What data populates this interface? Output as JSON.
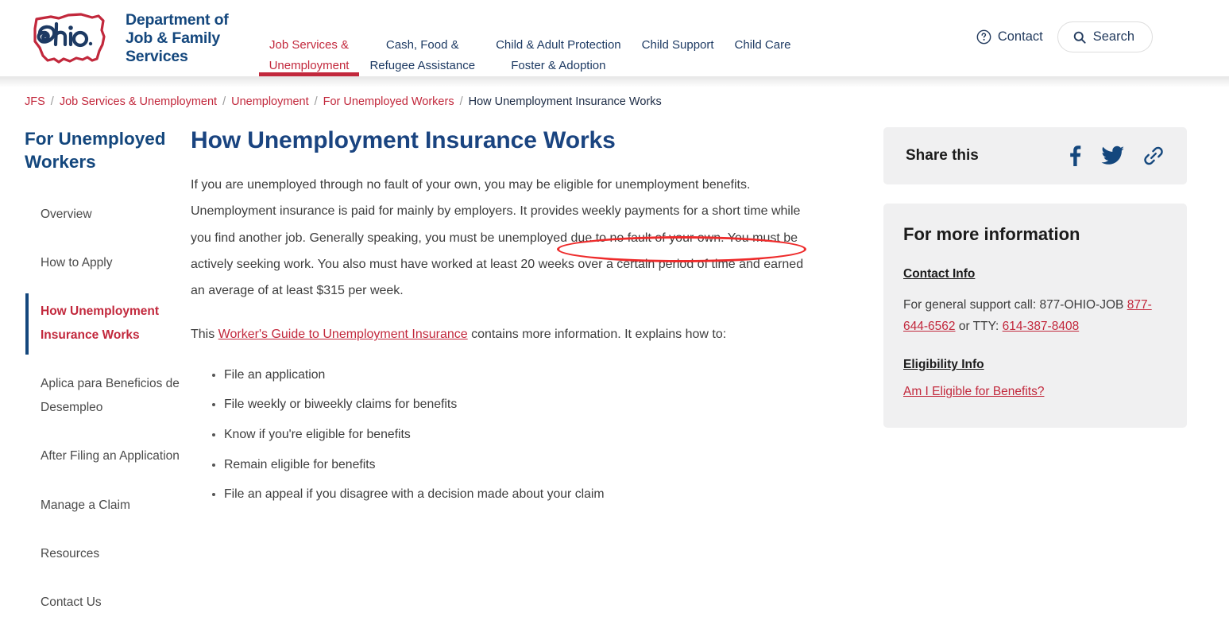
{
  "header": {
    "logo": {
      "icon": "ohio-state-outline-logo",
      "script_word": "Ohio",
      "agency_line1": "Department of",
      "agency_line2": "Job & Family",
      "agency_line3": "Services"
    },
    "nav": [
      {
        "label": "Job Services &\nUnemployment",
        "active": true
      },
      {
        "label": "Cash, Food &\nRefugee Assistance",
        "active": false
      },
      {
        "label": "Child & Adult Protection\nFoster & Adoption",
        "active": false
      },
      {
        "label": "Child Support",
        "active": false
      },
      {
        "label": "Child Care",
        "active": false
      }
    ],
    "contact_label": "Contact",
    "contact_icon": "question-circle-icon",
    "search_label": "Search",
    "search_icon": "search-icon"
  },
  "breadcrumb": {
    "items": [
      {
        "label": "JFS",
        "current": false
      },
      {
        "label": "Job Services & Unemployment",
        "current": false
      },
      {
        "label": "Unemployment",
        "current": false
      },
      {
        "label": "For Unemployed Workers",
        "current": false
      },
      {
        "label": "How Unemployment Insurance Works",
        "current": true
      }
    ],
    "separator": "/"
  },
  "sidebar": {
    "title": "For Unemployed Workers",
    "items": [
      {
        "label": "Overview",
        "active": false
      },
      {
        "label": "How to Apply",
        "active": false
      },
      {
        "label": "How Unemployment Insurance Works",
        "active": true
      },
      {
        "label": "Aplica para Beneficios de Desempleo",
        "active": false
      },
      {
        "label": "After Filing an Application",
        "active": false
      },
      {
        "label": "Manage a Claim",
        "active": false
      },
      {
        "label": "Resources",
        "active": false
      },
      {
        "label": "Contact Us",
        "active": false
      }
    ]
  },
  "main": {
    "title": "How Unemployment Insurance Works",
    "paragraph1": "If you are unemployed through no fault of your own, you may be eligible for unemployment benefits. Unemployment insurance is paid for mainly by employers.  It provides weekly payments for a short time while you find another job. Generally speaking, you must be unemployed due to no fault of your own. You must be actively seeking work. You also must have worked at least 20 weeks over a certain period of time and earned an average of at least $315 per week.",
    "paragraph2_prefix": "This ",
    "paragraph2_link": "Worker's Guide to Unemployment Insurance",
    "paragraph2_suffix": " contains more information. It explains how to:",
    "bullets": [
      "File an application",
      "File weekly or biweekly claims for benefits",
      "Know if you're eligible for benefits",
      "Remain eligible for benefits",
      "File an appeal if you disagree with a decision made about your claim"
    ],
    "annotation": {
      "type": "red-ellipse-highlight",
      "encircled_text": "and earned an average of at least $315 per",
      "color": "#ee2b2b"
    }
  },
  "right_rail": {
    "share": {
      "label": "Share this",
      "icons": [
        {
          "name": "facebook-icon"
        },
        {
          "name": "twitter-icon"
        },
        {
          "name": "link-icon"
        }
      ]
    },
    "info": {
      "title": "For more information",
      "contact_heading": "Contact Info",
      "contact_text_prefix": "For general support call: 877-OHIO-JOB ",
      "contact_phone1": "877-644-6562",
      "contact_text_middle": " or TTY: ",
      "contact_phone2": "614-387-8408",
      "eligibility_heading": "Eligibility Info",
      "eligibility_link": "Am I Eligible for Benefits?"
    }
  },
  "colors": {
    "brand_navy": "#14477d",
    "brand_red": "#c2283c",
    "annotation_red": "#ee2b2b",
    "panel_gray": "#f0f0f1",
    "body_text": "#3d3d3d"
  }
}
